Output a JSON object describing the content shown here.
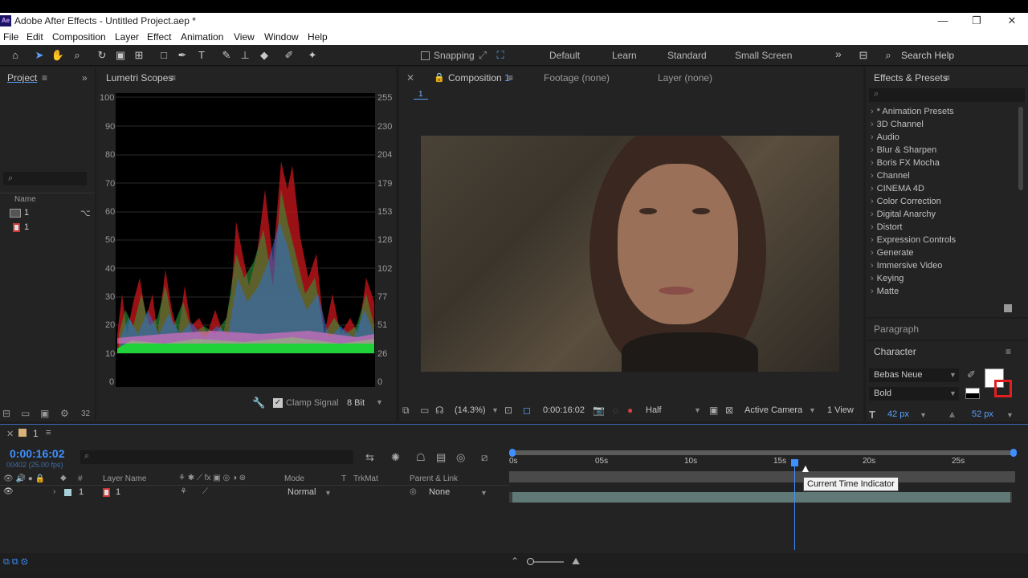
{
  "window": {
    "title": "Adobe After Effects - Untitled Project.aep *",
    "app_icon": "Ae",
    "minimize": "—",
    "restore": "❐",
    "close": "✕"
  },
  "menu": [
    "File",
    "Edit",
    "Composition",
    "Layer",
    "Effect",
    "Animation",
    "View",
    "Window",
    "Help"
  ],
  "toolbar": {
    "snapping_label": "Snapping",
    "workspaces": [
      "Default",
      "Learn",
      "Standard",
      "Small Screen"
    ],
    "search_help": "Search Help",
    "more": "»"
  },
  "project": {
    "tab": "Project",
    "name_col": "Name",
    "items": [
      {
        "name": "1",
        "type": "composition"
      },
      {
        "name": "1",
        "type": "footage"
      }
    ],
    "bit_depth": "32"
  },
  "scopes": {
    "tab": "Lumetri Scopes",
    "left_ticks": [
      "100",
      "90",
      "80",
      "70",
      "60",
      "50",
      "40",
      "30",
      "20",
      "10",
      "0"
    ],
    "right_ticks": [
      "255",
      "230",
      "204",
      "179",
      "153",
      "128",
      "102",
      "77",
      "51",
      "26",
      "0"
    ],
    "clamp_label": "Clamp Signal",
    "bit_value": "8 Bit"
  },
  "viewer": {
    "tab_comp": "Composition",
    "comp_name": "1",
    "tab_footage": "Footage (none)",
    "tab_layer": "Layer (none)",
    "breadcrumb": "1",
    "zoom": "(14.3%)",
    "timecode": "0:00:16:02",
    "resolution": "Half",
    "camera": "Active Camera",
    "views": "1 View"
  },
  "effects": {
    "tab": "Effects & Presets",
    "items": [
      "* Animation Presets",
      "3D Channel",
      "Audio",
      "Blur & Sharpen",
      "Boris FX Mocha",
      "Channel",
      "CINEMA 4D",
      "Color Correction",
      "Digital Anarchy",
      "Distort",
      "Expression Controls",
      "Generate",
      "Immersive Video",
      "Keying",
      "Matte"
    ]
  },
  "paragraph": {
    "tab": "Paragraph"
  },
  "character": {
    "tab": "Character",
    "font": "Bebas Neue",
    "style": "Bold",
    "size": "42 px",
    "tracking": "52 px",
    "size_unit_caret": "▼"
  },
  "timeline": {
    "comp_tab": "1",
    "timecode": "0:00:16:02",
    "frame_info": "00402 (25.00 fps)",
    "col_num": "#",
    "col_layername": "Layer Name",
    "col_mode": "Mode",
    "col_t": "T",
    "col_trkmat": "TrkMat",
    "col_parent": "Parent & Link",
    "ruler": [
      "0s",
      "05s",
      "10s",
      "15s",
      "20s",
      "25s"
    ],
    "layer": {
      "num": "1",
      "name": "1",
      "mode": "Normal",
      "parent": "None"
    },
    "tooltip": "Current Time Indicator",
    "playhead_fraction": 0.5642
  }
}
